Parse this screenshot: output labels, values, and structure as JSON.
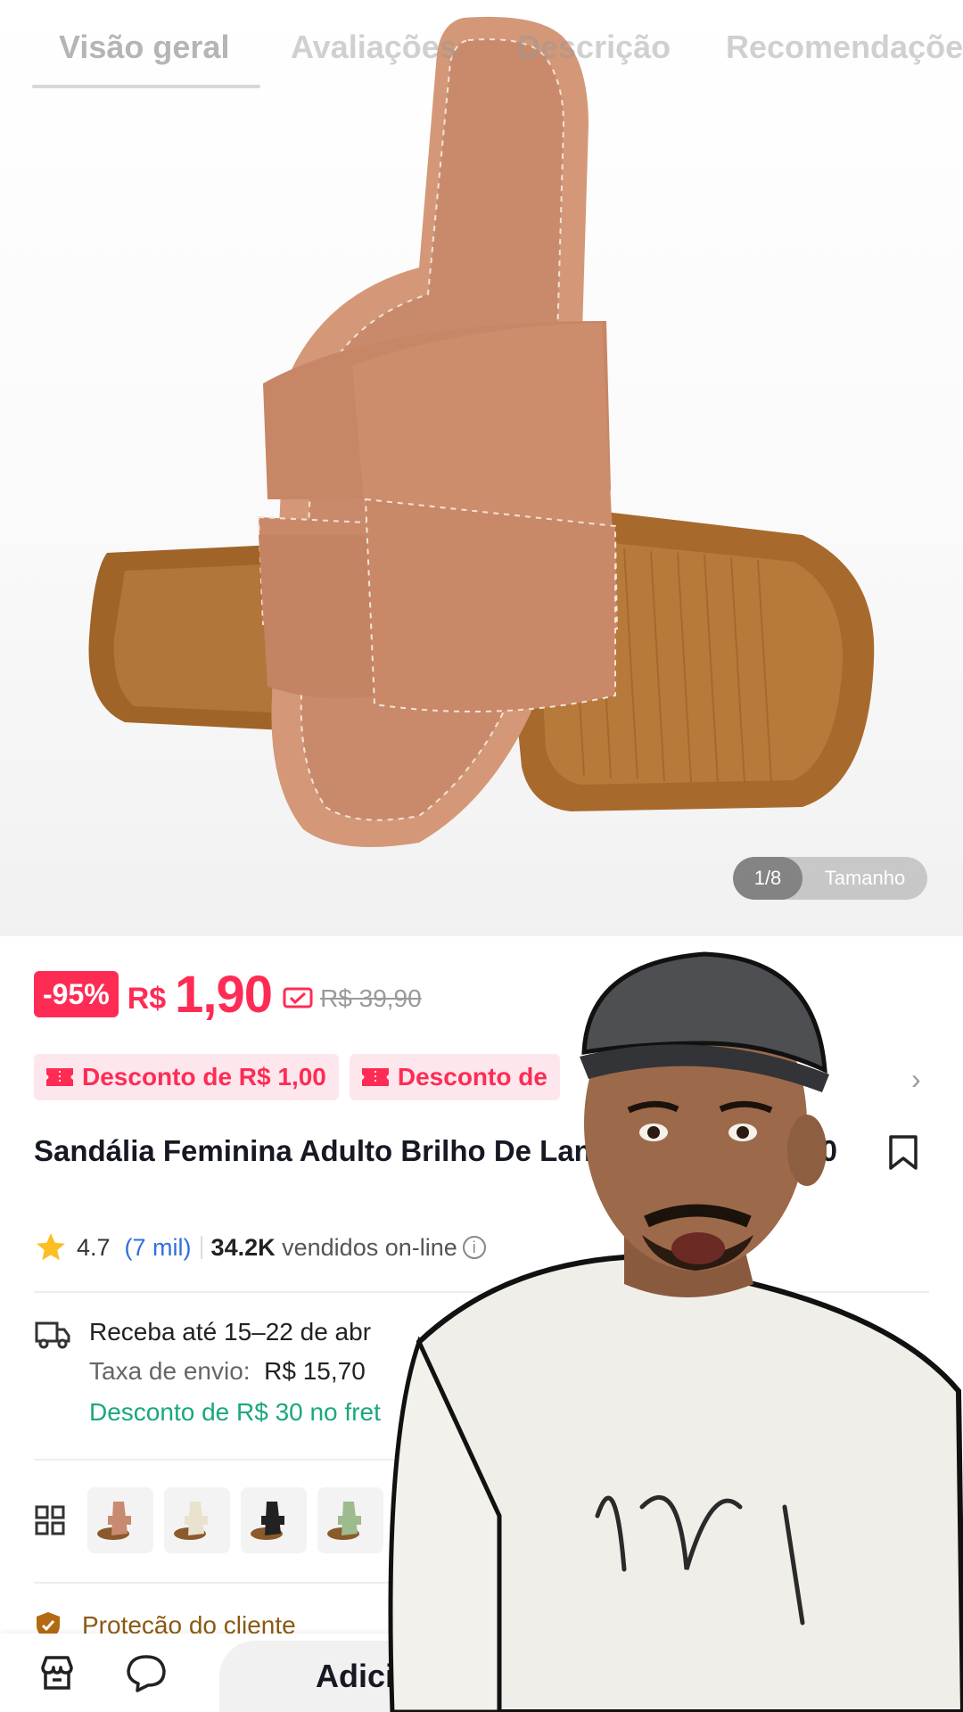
{
  "tabs": [
    {
      "label": "Visão geral",
      "active": true
    },
    {
      "label": "Avaliações",
      "active": false
    },
    {
      "label": "Descrição",
      "active": false
    },
    {
      "label": "Recomendações",
      "active": false
    }
  ],
  "gallery": {
    "counter": "1/8",
    "size_label": "Tamanho"
  },
  "price": {
    "discount_badge": "-95%",
    "currency": "R$",
    "value": "1,90",
    "original": "R$ 39,90"
  },
  "coupons": [
    "Desconto de R$ 1,00",
    "Desconto de"
  ],
  "product": {
    "title": "Sandália Feminina Adulto Brilho De Lançamento 34 ao 40"
  },
  "rating": {
    "score": "4.7",
    "reviews": "(7 mil)",
    "sold_count": "34.2K",
    "sold_label": "vendidos on-line"
  },
  "shipping": {
    "delivery": "Receba até 15–22 de abr",
    "fee_label": "Taxa de envio:",
    "fee_value": "R$ 15,70",
    "discount": "Desconto de R$ 30 no fret"
  },
  "variants": [
    {
      "color": "#c98a72"
    },
    {
      "color": "#e8e2cf"
    },
    {
      "color": "#222222"
    },
    {
      "color": "#9dbb8e"
    },
    {
      "color": "#c98a72"
    }
  ],
  "protection": {
    "label": "Proteção do cliente"
  },
  "bottom_bar": {
    "add_label": "Adicionar ao carrinho"
  },
  "colors": {
    "accent": "#fe2c55",
    "coupon_bg": "#fde7ec",
    "shipping_discount": "#1aa77f",
    "link": "#2f6fde"
  }
}
